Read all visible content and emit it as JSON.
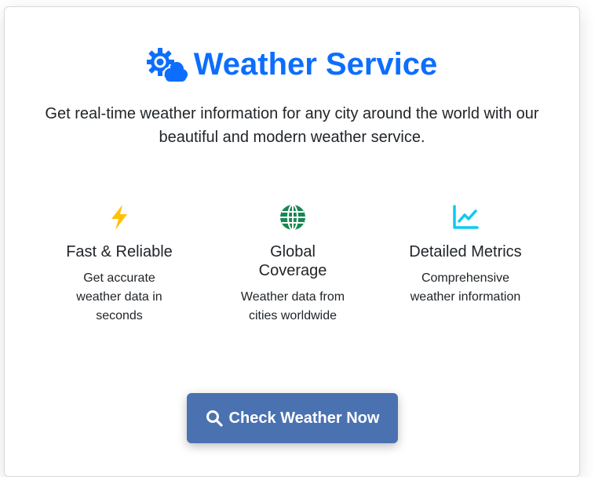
{
  "header": {
    "icon": "sun-cloud-icon",
    "title": "Weather Service",
    "color": "#0d6efd"
  },
  "subtitle": "Get real-time weather information for any city around the world with our beautiful and modern weather service.",
  "features": [
    {
      "icon": "lightning-bolt-icon",
      "icon_color": "#ffc107",
      "title": "Fast & Reliable",
      "description": "Get accurate weather data in seconds"
    },
    {
      "icon": "globe-icon",
      "icon_color": "#198754",
      "title": "Global Coverage",
      "description": "Weather data from cities worldwide"
    },
    {
      "icon": "line-chart-icon",
      "icon_color": "#0dcaf0",
      "title": "Detailed Metrics",
      "description": "Comprehensive weather information"
    }
  ],
  "cta": {
    "icon": "search-icon",
    "label": "Check Weather Now",
    "background": "#4a72b0"
  }
}
